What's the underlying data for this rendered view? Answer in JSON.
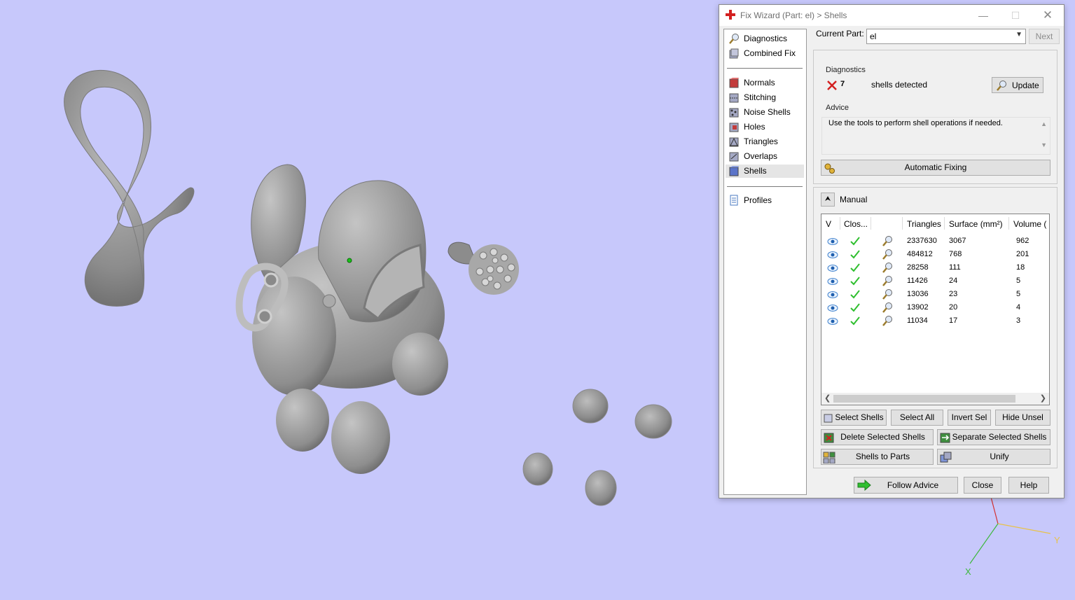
{
  "dialog": {
    "title": "Fix Wizard (Part: el) > Shells",
    "current_part_label": "Current Part:",
    "current_part_value": "el",
    "next_label": "Next"
  },
  "nav": {
    "diagnostics": "Diagnostics",
    "combined_fix": "Combined Fix",
    "normals": "Normals",
    "stitching": "Stitching",
    "noise_shells": "Noise Shells",
    "holes": "Holes",
    "triangles": "Triangles",
    "overlaps": "Overlaps",
    "shells": "Shells",
    "profiles": "Profiles",
    "selected": "Shells"
  },
  "diagnostics": {
    "heading": "Diagnostics",
    "count": "7",
    "status_text": "shells detected",
    "update_label": "Update"
  },
  "advice": {
    "heading": "Advice",
    "text": "Use the tools to perform shell operations if needed.",
    "automatic_fixing_label": "Automatic Fixing"
  },
  "manual": {
    "heading": "Manual",
    "columns": [
      "V",
      "Clos...",
      "",
      "Triangles",
      "Surface (mm²)",
      "Volume ("
    ],
    "rows": [
      {
        "triangles": "2337630",
        "surface": "3067",
        "volume": "962"
      },
      {
        "triangles": "484812",
        "surface": "768",
        "volume": "201"
      },
      {
        "triangles": "28258",
        "surface": "111",
        "volume": "18"
      },
      {
        "triangles": "11426",
        "surface": "24",
        "volume": "5"
      },
      {
        "triangles": "13036",
        "surface": "23",
        "volume": "5"
      },
      {
        "triangles": "13902",
        "surface": "20",
        "volume": "4"
      },
      {
        "triangles": "11034",
        "surface": "17",
        "volume": "3"
      }
    ],
    "select_shells": "Select Shells",
    "select_all": "Select All",
    "invert_sel": "Invert Sel",
    "hide_unsel": "Hide Unsel",
    "delete_selected": "Delete Selected Shells",
    "separate_selected": "Separate Selected Shells",
    "shells_to_parts": "Shells to Parts",
    "unify": "Unify"
  },
  "footer": {
    "follow_advice": "Follow Advice",
    "close": "Close",
    "help": "Help"
  },
  "axes": {
    "x": "X",
    "y": "Y"
  },
  "colors": {
    "background": "#c7c8fb",
    "model_gray": "#9a9a9a",
    "check_green": "#2fbf2f",
    "error_red": "#d32020",
    "axis_x": "#3cb83c",
    "axis_y": "#e8c24a",
    "axis_z": "#d43030"
  }
}
